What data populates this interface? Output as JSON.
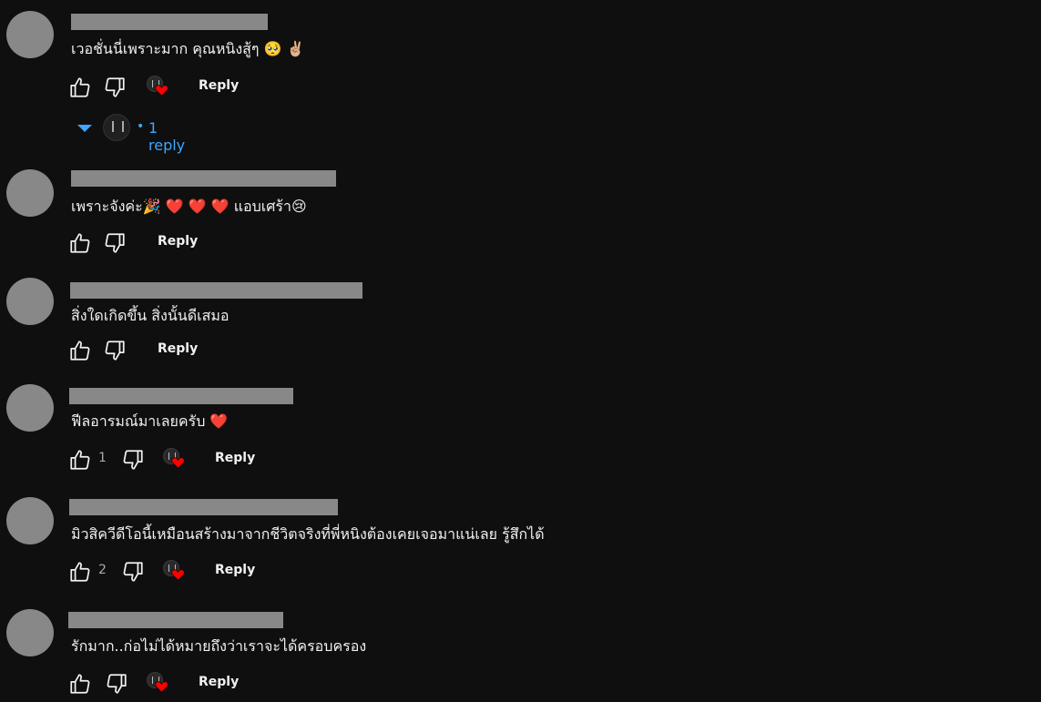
{
  "comments": [
    {
      "text": "เวอชั่นนี่เพราะมาก คุณหนิงสู้ๆ 🥺 ✌🏼",
      "likes": "",
      "reply_label": "Reply",
      "creator_heart": true,
      "replies_toggle": {
        "count_label": "1 reply"
      }
    },
    {
      "text": "เพราะจังค่ะ🎉 ❤️ ❤️ ❤️ แอบเศร้า😢",
      "likes": "",
      "reply_label": "Reply",
      "creator_heart": false
    },
    {
      "text": "สิ่งใดเกิดขึ้น สิ่งนั้นดีเสมอ",
      "likes": "",
      "reply_label": "Reply",
      "creator_heart": false
    },
    {
      "text": "ฟีลอารมณ์มาเลยครับ ❤️",
      "likes": "1",
      "reply_label": "Reply",
      "creator_heart": true
    },
    {
      "text": "มิวสิควีดีโอนี้เหมือนสร้างมาจากชีวิตจริงที่พี่หนิงต้องเคยเจอมาแน่เลย รู้สึกได้",
      "likes": "2",
      "reply_label": "Reply",
      "creator_heart": true
    },
    {
      "text": "รักมาก..ก่อไม่ได้หมายถึงว่าเราจะได้ครอบครอง",
      "likes": "",
      "reply_label": "Reply",
      "creator_heart": true
    }
  ],
  "theme": {
    "background": "#0f0f0f",
    "text": "#f1f1f1",
    "link": "#3ea6ff",
    "heart": "#ff0000",
    "redaction": "#888888"
  },
  "icons": {
    "like": "thumbs-up-icon",
    "dislike": "thumbs-down-icon",
    "heart": "creator-heart-icon",
    "expand": "caret-down-icon"
  }
}
